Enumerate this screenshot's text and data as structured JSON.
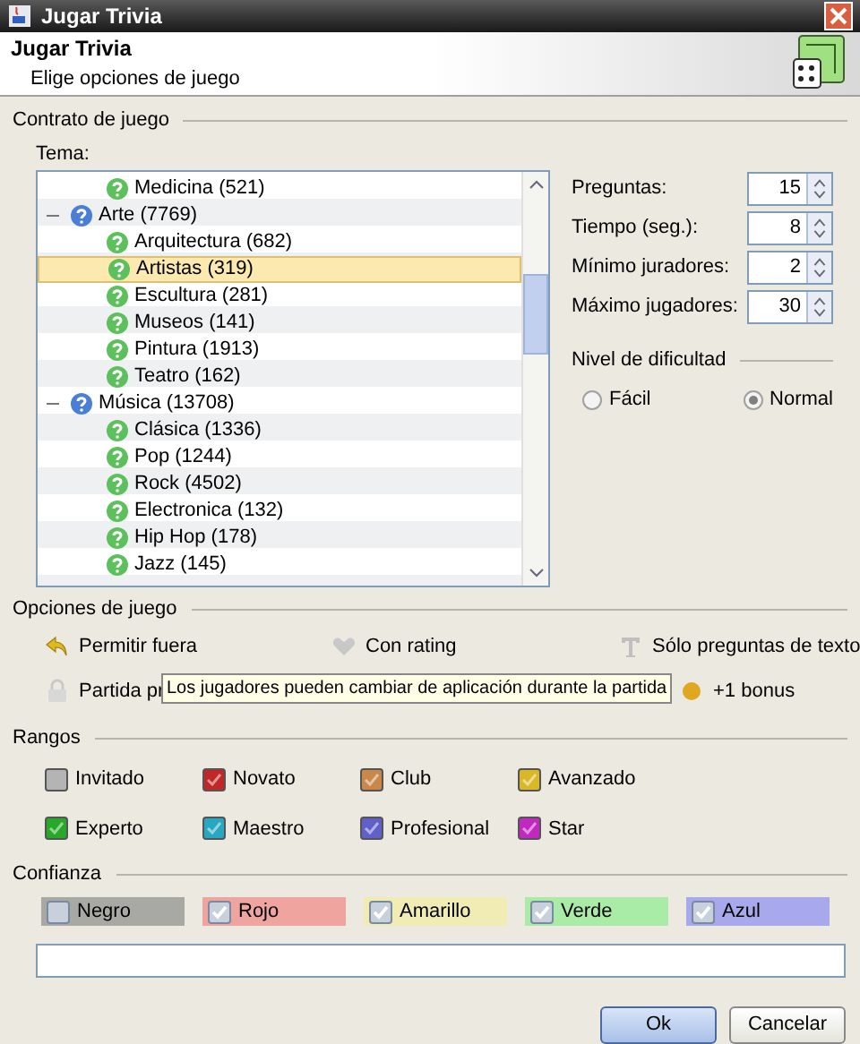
{
  "window": {
    "title": "Jugar Trivia"
  },
  "header": {
    "title": "Jugar Trivia",
    "subtitle": "Elige opciones de juego"
  },
  "contract": {
    "title": "Contrato de juego",
    "tree_label": "Tema:",
    "tree": [
      {
        "children": [
          {
            "label": "Medicina (521)",
            "selected": false
          }
        ]
      },
      {
        "label": "Arte (7769)",
        "expanded": true,
        "selected": false,
        "children": [
          {
            "label": "Arquitectura (682)",
            "selected": false
          },
          {
            "label": "Artistas (319)",
            "selected": true
          },
          {
            "label": "Escultura (281)",
            "selected": false
          },
          {
            "label": "Museos (141)",
            "selected": false
          },
          {
            "label": "Pintura (1913)",
            "selected": false
          },
          {
            "label": "Teatro (162)",
            "selected": false
          }
        ]
      },
      {
        "label": "Música (13708)",
        "expanded": true,
        "selected": false,
        "children": [
          {
            "label": "Clásica (1336)",
            "selected": false
          },
          {
            "label": "Pop (1244)",
            "selected": false
          },
          {
            "label": "Rock (4502)",
            "selected": false
          },
          {
            "label": "Electronica (132)",
            "selected": false
          },
          {
            "label": "Hip Hop (178)",
            "selected": false
          },
          {
            "label": "Jazz (145)",
            "selected": false
          }
        ]
      }
    ],
    "spinners": [
      {
        "label": "Preguntas:",
        "value": "15"
      },
      {
        "label": "Tiempo (seg.):",
        "value": "8"
      },
      {
        "label": "Mínimo juradores:",
        "value": "2"
      },
      {
        "label": "Máximo jugadores:",
        "value": "30"
      }
    ],
    "difficulty": {
      "title": "Nivel de dificultad",
      "options": [
        {
          "label": "Fácil",
          "selected": false
        },
        {
          "label": "Normal",
          "selected": true
        }
      ]
    }
  },
  "game_options": {
    "title": "Opciones de juego",
    "options": [
      {
        "label": "Permitir fuera",
        "kind": "arrow",
        "on": true
      },
      {
        "label": "Con rating",
        "kind": "heart",
        "on": false
      },
      {
        "label": "Sólo preguntas de texto",
        "kind": "text",
        "on": false
      },
      {
        "label": "Partida pr",
        "kind": "lock",
        "on": false
      },
      {
        "label": "+1 bonus",
        "kind": "bonus",
        "on": true
      }
    ],
    "tooltip": "Los jugadores pueden cambiar de aplicación durante la partida"
  },
  "ranks": {
    "title": "Rangos",
    "items": [
      {
        "label": "Invitado",
        "color": "#b4b4b4",
        "checked": false
      },
      {
        "label": "Novato",
        "color": "#c02828",
        "checked": true
      },
      {
        "label": "Club",
        "color": "#c8884a",
        "checked": true
      },
      {
        "label": "Avanzado",
        "color": "#d8b828",
        "checked": true
      },
      {
        "label": "Experto",
        "color": "#28a828",
        "checked": true
      },
      {
        "label": "Maestro",
        "color": "#28a8c0",
        "checked": true
      },
      {
        "label": "Profesional",
        "color": "#6060c8",
        "checked": true
      },
      {
        "label": "Star",
        "color": "#c028c0",
        "checked": true
      }
    ]
  },
  "trust": {
    "title": "Confianza",
    "items": [
      {
        "label": "Negro",
        "color": "#a8a8a4",
        "checked": false
      },
      {
        "label": "Rojo",
        "color": "#f0a4a0",
        "checked": true
      },
      {
        "label": "Amarillo",
        "color": "#f0ecb4",
        "checked": true
      },
      {
        "label": "Verde",
        "color": "#a8eca8",
        "checked": true
      },
      {
        "label": "Azul",
        "color": "#a8a8ec",
        "checked": true
      }
    ]
  },
  "buttons": [
    {
      "label": "Ok",
      "default": true
    },
    {
      "label": "Cancelar",
      "default": false
    }
  ]
}
